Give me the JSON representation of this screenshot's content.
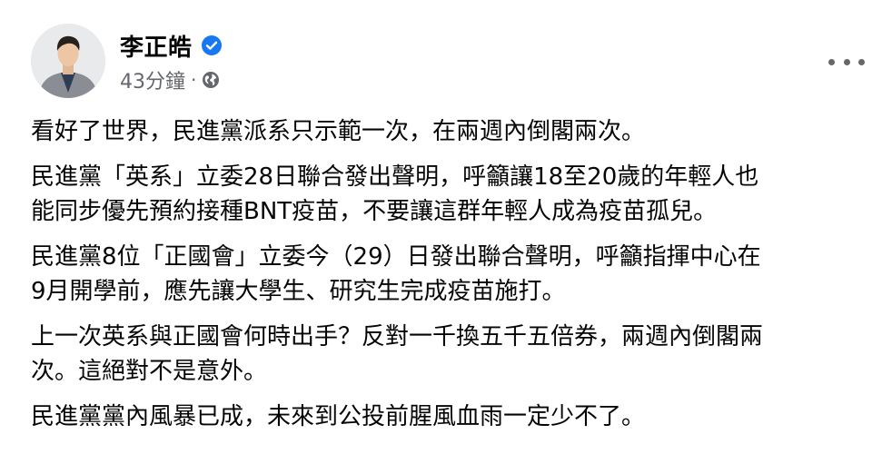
{
  "post": {
    "author": {
      "name": "李正皓",
      "verified_icon": "verified-badge-icon",
      "avatar": "profile-photo"
    },
    "meta": {
      "time": "43分鐘",
      "separator": "·",
      "privacy_icon": "globe-icon"
    },
    "more_icon": "more-options-icon",
    "paragraphs": [
      "看好了世界，民進黨派系只示範一次，在兩週內倒閣兩次。",
      "民進黨「英系」立委28日聯合發出聲明，呼籲讓18至20歲的年輕人也\n能同步優先預約接種BNT疫苗，不要讓這群年輕人成為疫苗孤兒。",
      "民進黨8位「正國會」立委今（29）日發出聯合聲明，呼籲指揮中心在\n9月開學前，應先讓大學生、研究生完成疫苗施打。",
      "上一次英系與正國會何時出手？反對一千換五千五倍券，兩週內倒閣兩\n次。這絕對不是意外。",
      "民進黨黨內風暴已成，未來到公投前腥風血雨一定少不了。"
    ]
  },
  "colors": {
    "text_primary": "#050505",
    "text_secondary": "#65676b",
    "verified_blue": "#1877f2"
  }
}
